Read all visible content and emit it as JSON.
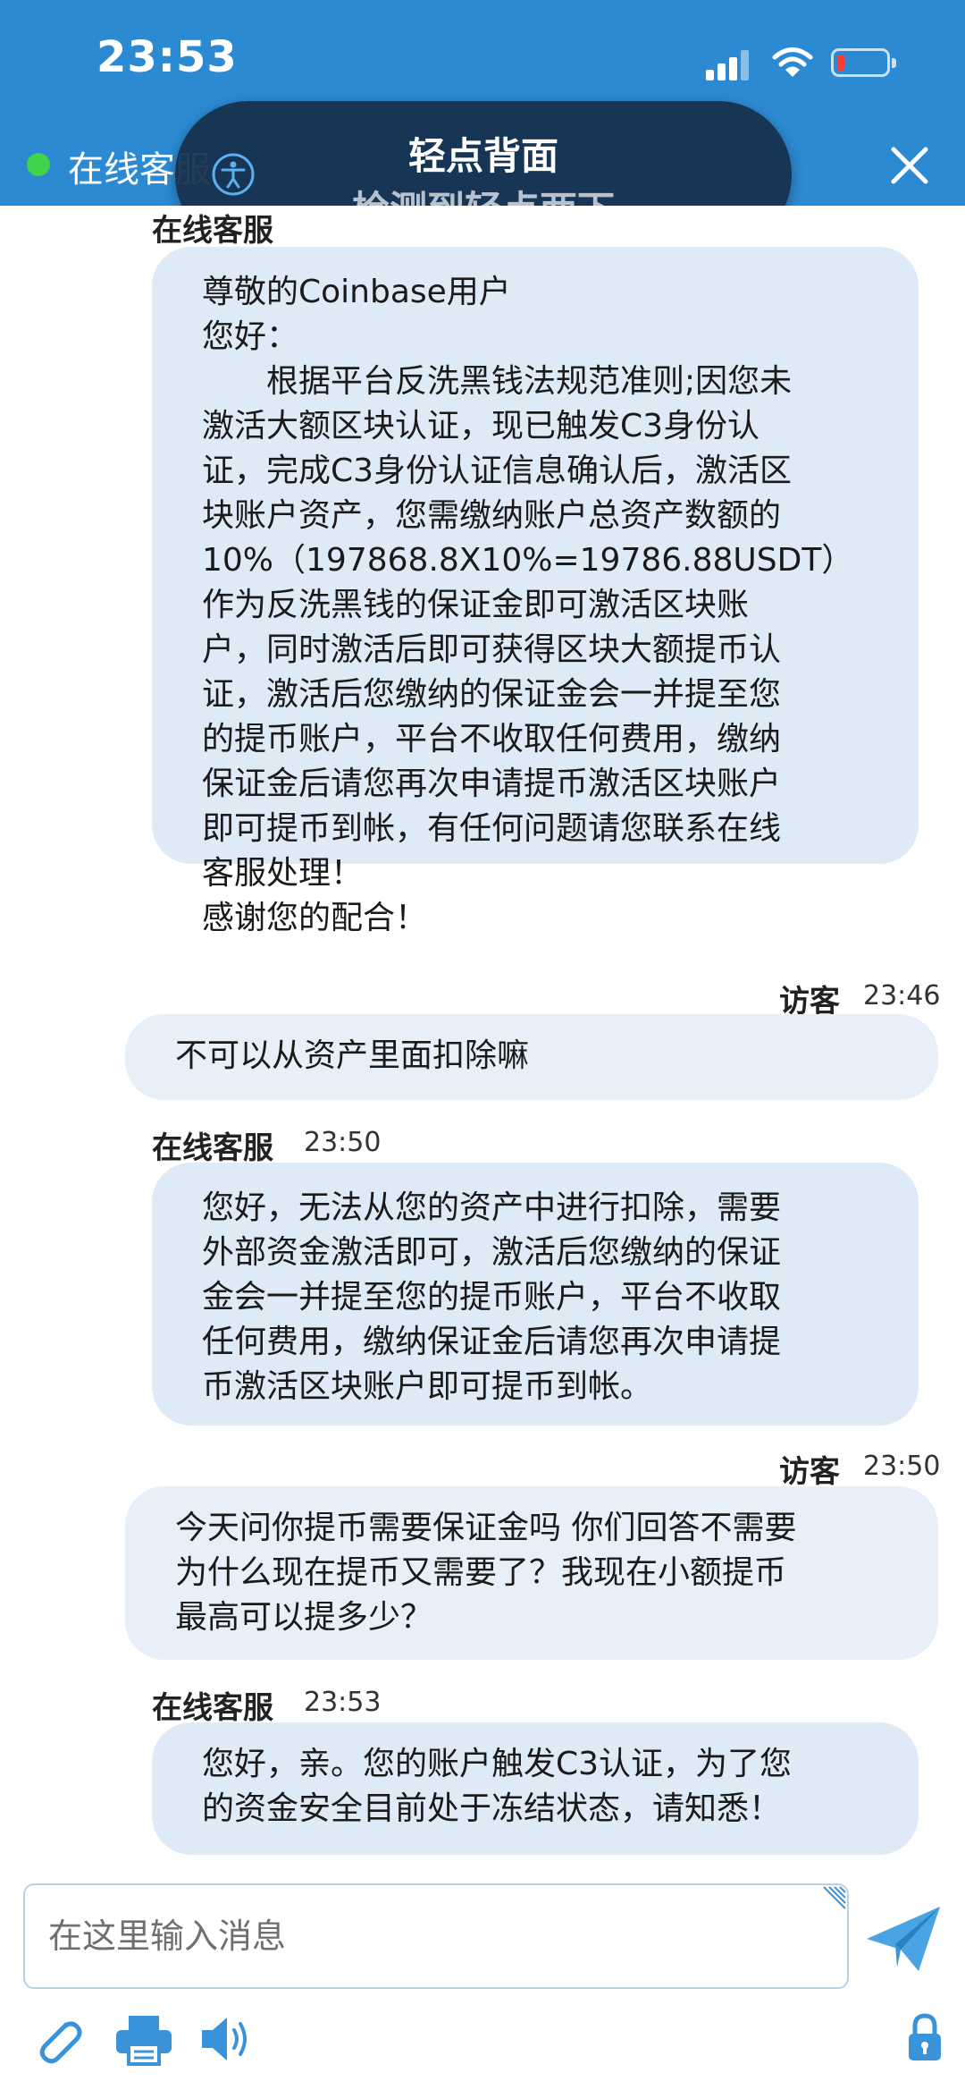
{
  "status_bar": {
    "time": "23:53"
  },
  "header": {
    "title": "在线客服"
  },
  "toast": {
    "title": "轻点背面",
    "subtitle": "检测到轻点两下"
  },
  "messages": [
    {
      "from": "agent",
      "sender": "在线客服",
      "time": "",
      "text": "尊敬的Coinbase用户\n您好：\n　　根据平台反洗黑钱法规范准则;因您未\n激活大额区块认证，现已触发C3身份认\n证，完成C3身份认证信息确认后，激活区\n块账户资产，您需缴纳账户总资产数额的\n10%（197868.8X10%=19786.88USDT）\n作为反洗黑钱的保证金即可激活区块账\n户，同时激活后即可获得区块大额提币认\n证，激活后您缴纳的保证金会一并提至您\n的提币账户，平台不收取任何费用，缴纳\n保证金后请您再次申请提币激活区块账户\n即可提币到帐，有任何问题请您联系在线\n客服处理！\n感谢您的配合！"
    },
    {
      "from": "visitor",
      "sender": "访客",
      "time": "23:46",
      "text": "不可以从资产里面扣除嘛"
    },
    {
      "from": "agent",
      "sender": "在线客服",
      "time": "23:50",
      "text": "您好，无法从您的资产中进行扣除，需要\n外部资金激活即可，激活后您缴纳的保证\n金会一并提至您的提币账户，平台不收取\n任何费用，缴纳保证金后请您再次申请提\n币激活区块账户即可提币到帐。"
    },
    {
      "from": "visitor",
      "sender": "访客",
      "time": "23:50",
      "text": "今天问你提币需要保证金吗 你们回答不需要\n为什么现在提币又需要了？我现在小额提币\n最高可以提多少？"
    },
    {
      "from": "agent",
      "sender": "在线客服",
      "time": "23:53",
      "text": "您好，亲。您的账户触发C3认证，为了您\n的资金安全目前处于冻结状态，请知悉！"
    }
  ],
  "input": {
    "placeholder": "在这里输入消息"
  },
  "icons": {
    "signal": "signal-icon",
    "wifi": "wifi-icon",
    "battery": "battery-low-icon",
    "close": "close-icon",
    "accessibility": "accessibility-icon",
    "send": "paper-plane-icon",
    "attach": "paperclip-icon",
    "print": "printer-icon",
    "sound": "speaker-icon",
    "lock": "lock-icon"
  },
  "colors": {
    "header_blue": "#2c8ad3",
    "bubble_blue": "#deebf7",
    "online_green": "#3ed44b",
    "battery_red": "#ff3b30",
    "icon_blue": "#3a92d8"
  }
}
